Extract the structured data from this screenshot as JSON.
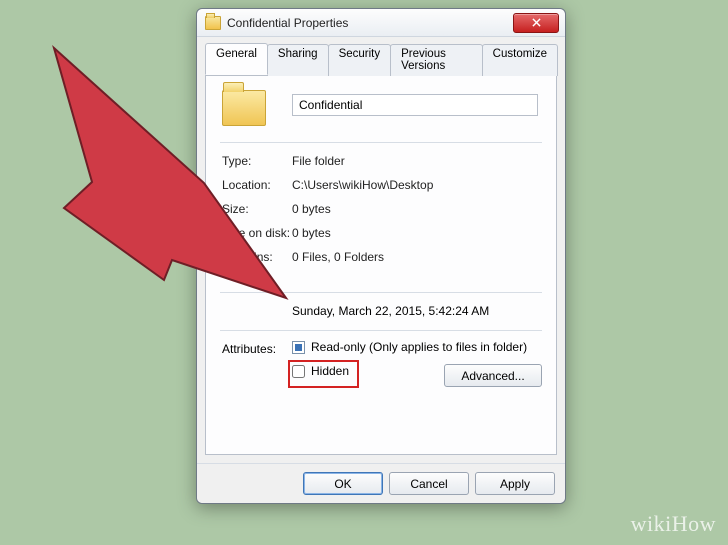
{
  "window": {
    "title": "Confidential Properties"
  },
  "tabs": {
    "general": "General",
    "sharing": "Sharing",
    "security": "Security",
    "versions": "Previous Versions",
    "customize": "Customize"
  },
  "general": {
    "name": "Confidential",
    "type_label": "Type:",
    "type_value": "File folder",
    "location_label": "Location:",
    "location_value": "C:\\Users\\wikiHow\\Desktop",
    "size_label": "Size:",
    "size_value": "0 bytes",
    "size_on_disk_label": "Size on disk:",
    "size_on_disk_value": "0 bytes",
    "contains_label": "Contains:",
    "contains_value": "0 Files, 0 Folders",
    "created_value": "Sunday, March 22, 2015, 5:42:24 AM",
    "attributes_label": "Attributes:",
    "readonly_label": "Read-only (Only applies to files in folder)",
    "hidden_label": "Hidden",
    "advanced_label": "Advanced..."
  },
  "buttons": {
    "ok": "OK",
    "cancel": "Cancel",
    "apply": "Apply"
  },
  "watermark": "wikiHow"
}
